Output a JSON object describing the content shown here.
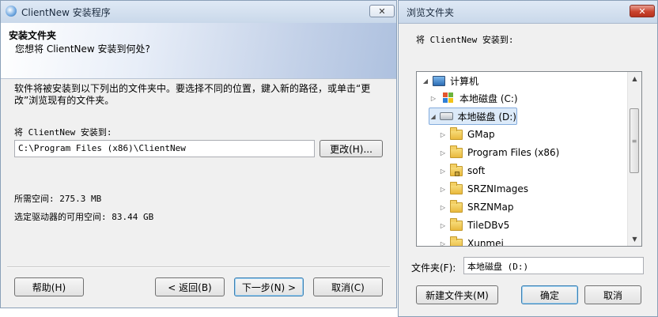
{
  "setup_window": {
    "title": "ClientNew 安装程序",
    "header_title": "安装文件夹",
    "header_subtitle": "您想将 ClientNew 安装到何处?",
    "instructions": [
      "软件将被安装到以下列出的文件夹中。要选择不同的位置，鍵入新的路径，或单击“更",
      "改”浏览现有的文件夹。"
    ],
    "install_to_label": "将 ClientNew 安装到:",
    "install_path": "C:\\Program Files (x86)\\ClientNew",
    "change_button": "更改(H)...",
    "required_space": "所需空间: 275.3 MB",
    "free_space": "选定驱动器的可用空间: 83.44 GB",
    "buttons": {
      "help": "帮助(H)",
      "back": "< 返回(B)",
      "next": "下一步(N) >",
      "cancel": "取消(C)"
    }
  },
  "browse_dialog": {
    "title": "浏览文件夹",
    "install_to_label": "将 ClientNew 安装到:",
    "tree": [
      {
        "label": "计算机",
        "icon": "computer-icon",
        "expander": "expanded"
      },
      {
        "label": "本地磁盘 (C:)",
        "icon": "windows-drive-icon",
        "expander": "collapsed"
      },
      {
        "label": "本地磁盘 (D:)",
        "icon": "drive-icon",
        "expander": "expanded",
        "selected": true
      },
      {
        "label": "GMap",
        "icon": "folder-icon",
        "expander": "collapsed"
      },
      {
        "label": "Program Files (x86)",
        "icon": "folder-icon",
        "expander": "collapsed"
      },
      {
        "label": "soft",
        "icon": "locked-folder-icon",
        "expander": "collapsed"
      },
      {
        "label": "SRZNImages",
        "icon": "folder-icon",
        "expander": "collapsed"
      },
      {
        "label": "SRZNMap",
        "icon": "folder-icon",
        "expander": "collapsed"
      },
      {
        "label": "TileDBv5",
        "icon": "folder-icon",
        "expander": "collapsed"
      },
      {
        "label": "Xunmei",
        "icon": "folder-icon",
        "expander": "collapsed"
      }
    ],
    "folder_label": "文件夹(F):",
    "folder_value": "本地磁盘 (D:)",
    "buttons": {
      "new_folder": "新建文件夹(M)",
      "ok": "确定",
      "cancel": "取消"
    }
  }
}
